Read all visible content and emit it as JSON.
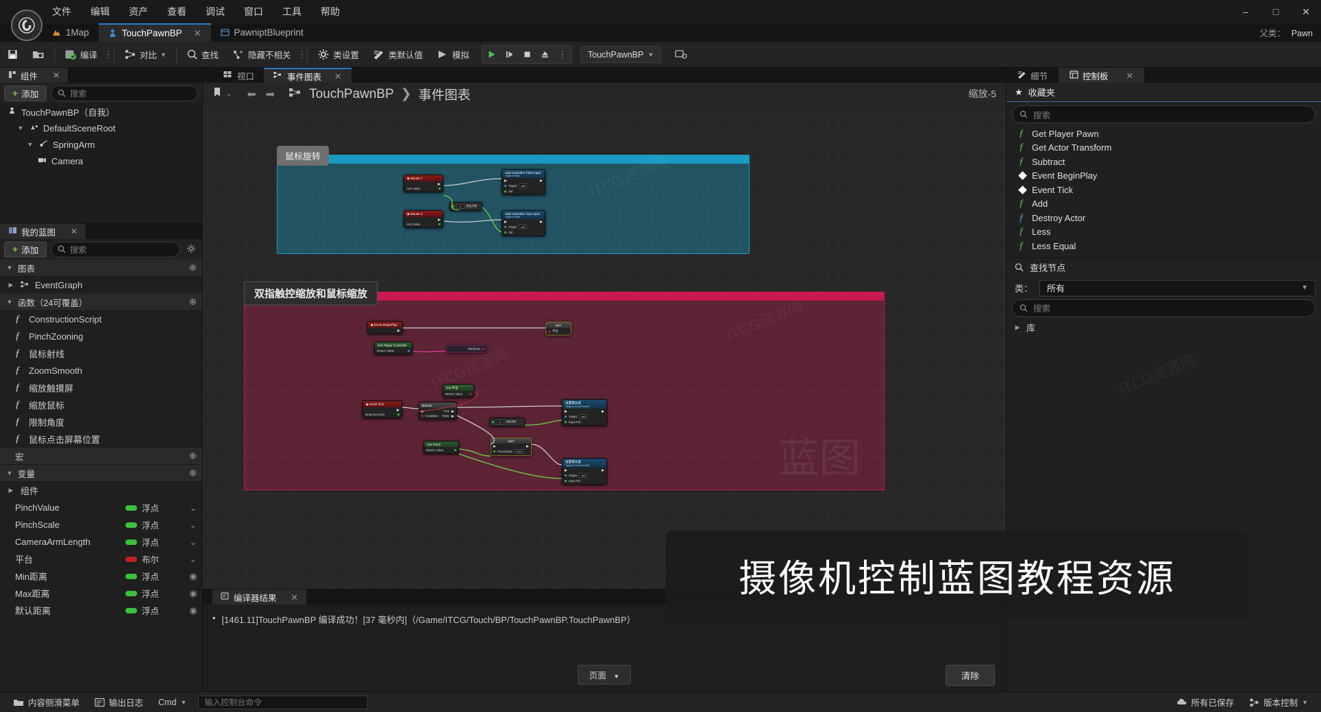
{
  "titlebar": {
    "logo": "ue-logo",
    "menu": [
      "文件",
      "编辑",
      "资产",
      "查看",
      "调试",
      "窗口",
      "工具",
      "帮助"
    ],
    "minimize": "–",
    "maximize": "□",
    "close": "✕"
  },
  "tabs": [
    {
      "label": "1Map",
      "icon": "map-icon",
      "active": false,
      "closable": false
    },
    {
      "label": "TouchPawnBP",
      "icon": "pawn-icon",
      "active": true,
      "closable": true
    },
    {
      "label": "PawniptBlueprint",
      "icon": "blueprint-icon",
      "active": false,
      "closable": false
    }
  ],
  "parent": {
    "label": "父类：",
    "value": "Pawn"
  },
  "toolbar": {
    "save": "保存",
    "browse": "浏览",
    "compile": "编译",
    "diff": "对比",
    "find": "查找",
    "hide_unrelated": "隐藏不相关",
    "class_settings": "类设置",
    "class_defaults": "类默认值",
    "simulate": "模拟",
    "play": "▶",
    "step": "▌▶",
    "stop": "■",
    "eject": "▲",
    "mode_combo": "TouchPawnBP"
  },
  "components_panel": {
    "tab_title": "组件",
    "add_label": "添加",
    "search_placeholder": "搜索",
    "tree": [
      {
        "label": "TouchPawnBP（自我）",
        "depth": 0,
        "icon": "pawn-icon",
        "caret": ""
      },
      {
        "label": "DefaultSceneRoot",
        "depth": 1,
        "icon": "scene-root-icon",
        "caret": "▼"
      },
      {
        "label": "SpringArm",
        "depth": 2,
        "icon": "spring-arm-icon",
        "caret": "▼"
      },
      {
        "label": "Camera",
        "depth": 3,
        "icon": "camera-icon",
        "caret": ""
      }
    ]
  },
  "myblueprint_panel": {
    "tab_title": "我的蓝图",
    "add_label": "添加",
    "search_placeholder": "搜索",
    "sections": {
      "graphs": "图表",
      "functions": "函数（24可覆盖）",
      "macros": "宏",
      "variables": "变量"
    },
    "graphs": [
      {
        "label": "EventGraph",
        "caret": "▶"
      }
    ],
    "functions": [
      "ConstructionScript",
      "PinchZooning",
      "鼠标射线",
      "ZoomSmooth",
      "缩放触摸屏",
      "缩放鼠标",
      "限制角度",
      "鼠标点击屏幕位置"
    ],
    "variables_group": "组件",
    "variables": [
      {
        "name": "PinchValue",
        "type": "浮点",
        "color": "#3ac23a",
        "eye": false
      },
      {
        "name": "PinchScale",
        "type": "浮点",
        "color": "#3ac23a",
        "eye": false
      },
      {
        "name": "CameraArmLength",
        "type": "浮点",
        "color": "#3ac23a",
        "eye": false
      },
      {
        "name": "平台",
        "type": "布尔",
        "color": "#c22020",
        "eye": false
      },
      {
        "name": "Min距离",
        "type": "浮点",
        "color": "#3ac23a",
        "eye": true
      },
      {
        "name": "Max距离",
        "type": "浮点",
        "color": "#3ac23a",
        "eye": true
      },
      {
        "name": "默认距离",
        "type": "浮点",
        "color": "#3ac23a",
        "eye": true
      }
    ]
  },
  "graph": {
    "tabs": [
      {
        "label": "视口",
        "icon": "viewport-icon",
        "active": false
      },
      {
        "label": "事件图表",
        "icon": "graph-icon",
        "active": true
      }
    ],
    "breadcrumb": {
      "root": "TouchPawnBP",
      "sep": "❯",
      "leaf": "事件图表"
    },
    "zoom_label": "缩放-5",
    "tooltip_top": "鼠标旋转",
    "tooltip_mid": "双指触控缩放和鼠标缩放",
    "comments": [
      {
        "title": "鼠标旋转",
        "color": "#1a9bc4"
      },
      {
        "title": "双指触控缩放和鼠标缩放",
        "color": "#c81a4f"
      }
    ],
    "nodes": [
      {
        "id": "mouseY",
        "title": "Mouse Y",
        "kind": "red",
        "pins": [
          "Axis Value"
        ]
      },
      {
        "id": "mouseX",
        "title": "Mouse X",
        "kind": "red",
        "pins": [
          "Axis Value"
        ]
      },
      {
        "id": "pitch",
        "title": "Add Controller Pitch Input",
        "sub": "Target is Pawn",
        "kind": "blue",
        "pins": [
          "Target",
          "Val"
        ],
        "target": "self"
      },
      {
        "id": "yaw",
        "title": "Add Controller Yaw Input",
        "sub": "Target is Pawn",
        "kind": "blue",
        "pins": [
          "Target",
          "Val"
        ],
        "target": "self"
      },
      {
        "id": "mulA",
        "title": "×",
        "kind": "grey",
        "value": "1.0",
        "vlabel": "鼠标灵敏"
      },
      {
        "id": "begin",
        "title": "Event BeginPlay",
        "kind": "red"
      },
      {
        "id": "getPC",
        "title": "Get Player Controller",
        "kind": "grn",
        "pins": [
          "Return Value"
        ]
      },
      {
        "id": "setA",
        "title": "SET",
        "kind": "grey",
        "pins": [
          "平台"
        ]
      },
      {
        "id": "isTouch",
        "title": "Windows",
        "kind": "purple"
      },
      {
        "id": "getVar1",
        "title": "Get 平台",
        "kind": "grn",
        "pins": [
          "Return Value"
        ]
      },
      {
        "id": "tick",
        "title": "Event Tick",
        "kind": "red",
        "pins": [
          "Delta Seconds"
        ]
      },
      {
        "id": "branch",
        "title": "Branch",
        "kind": "grey",
        "pins": [
          "Condition",
          "True",
          "False"
        ]
      },
      {
        "id": "setArm1",
        "title": "设置臂长度",
        "sub": "Target is TouchPawnBP",
        "kind": "blue",
        "pins": [
          "Target",
          "Input Pin"
        ],
        "target": "self"
      },
      {
        "id": "setArm2",
        "title": "设置臂长度",
        "sub": "Target is TouchPawnBP",
        "kind": "blue",
        "pins": [
          "Target",
          "Input Pin"
        ],
        "target": "self"
      },
      {
        "id": "getPinch",
        "title": "Get Pinch",
        "kind": "grn",
        "pins": [
          "Return Value"
        ]
      },
      {
        "id": "setPinch",
        "title": "SET",
        "kind": "grey",
        "pins": [
          "PinchScale"
        ],
        "value": "5000"
      },
      {
        "id": "mulB",
        "title": "×",
        "kind": "grey",
        "value": "1.0",
        "vlabel": "鼠标灵敏"
      }
    ]
  },
  "results_panel": {
    "tab_title": "编译器结果",
    "message": "[1461.11]TouchPawnBP  编译成功！[37 毫秒内]（/Game/ITCG/Touch/BP/TouchPawnBP.TouchPawnBP）",
    "page_label": "页面",
    "clear_label": "清除"
  },
  "right_panel": {
    "tabs": [
      {
        "label": "细节",
        "icon": "details-icon",
        "active": false
      },
      {
        "label": "控制板",
        "icon": "palette-icon",
        "active": true,
        "closable": true
      }
    ],
    "favorites_label": "收藏夹",
    "search_placeholder": "搜索",
    "favorites": [
      {
        "label": "Get Player Pawn",
        "icon": "function-green"
      },
      {
        "label": "Get Actor Transform",
        "icon": "function-green"
      },
      {
        "label": "Subtract",
        "icon": "function-green"
      },
      {
        "label": "Event BeginPlay",
        "icon": "event-diamond"
      },
      {
        "label": "Event Tick",
        "icon": "event-diamond"
      },
      {
        "label": "Add",
        "icon": "function-green"
      },
      {
        "label": "Destroy Actor",
        "icon": "function-blue"
      },
      {
        "label": "Less",
        "icon": "function-green"
      },
      {
        "label": "Less Equal",
        "icon": "function-green"
      }
    ],
    "find_node_label": "查找节点",
    "class_label": "类：",
    "class_value": "所有",
    "palette_search_placeholder": "搜索",
    "library_label": "库"
  },
  "statusbar": {
    "content_browser": "内容侧滑菜单",
    "output_log": "输出日志",
    "cmd_label": "Cmd",
    "cmd_placeholder": "输入控制台命令",
    "all_saved": "所有已保存",
    "source_control": "版本控制"
  },
  "overlay": {
    "banner_text": "摄像机控制蓝图教程资源",
    "watermark": "ITCG资源网",
    "watermark_big": "蓝图"
  }
}
